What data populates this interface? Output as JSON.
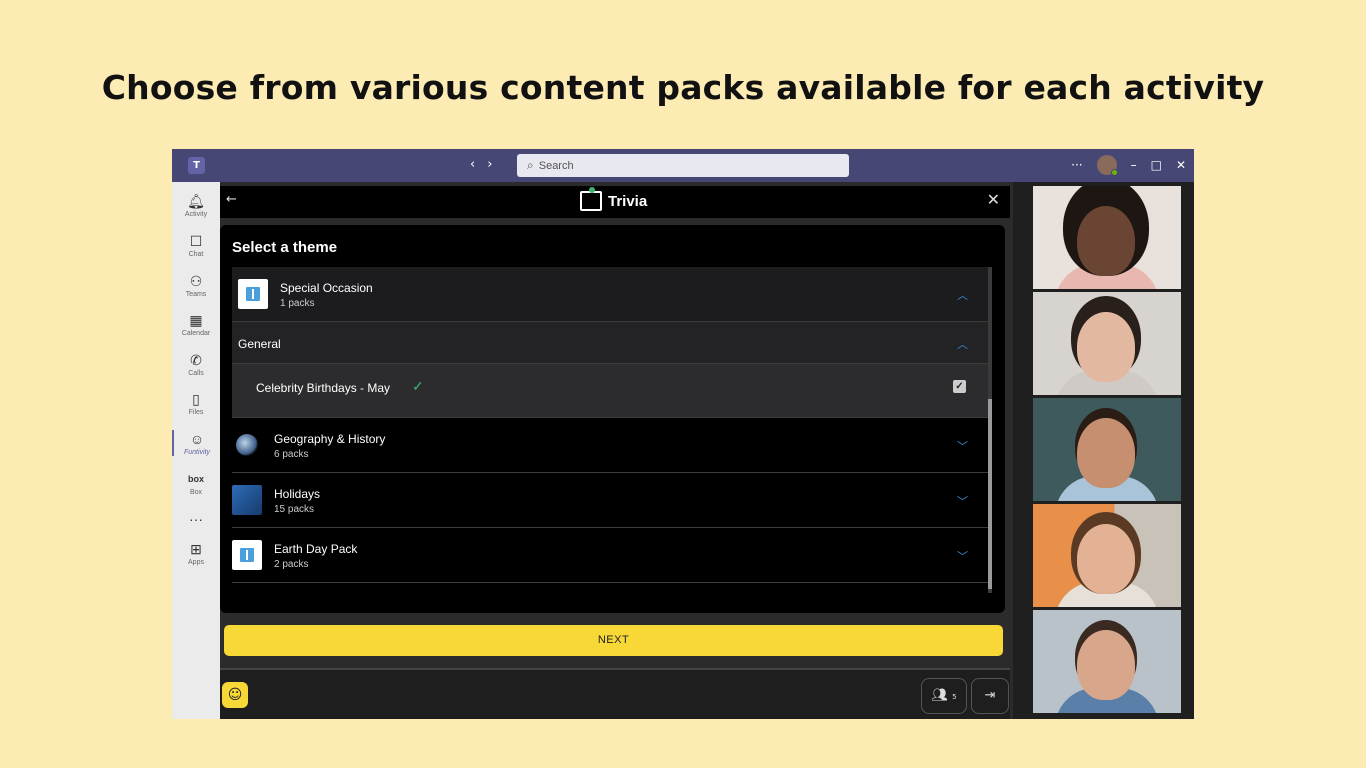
{
  "headline": "Choose from various content packs available for each activity",
  "titlebar": {
    "search_placeholder": "Search",
    "more": "···",
    "minimize": "–",
    "maximize": "□",
    "close": "✕"
  },
  "rail": {
    "items": [
      {
        "label": "Activity",
        "icon": "bell-icon"
      },
      {
        "label": "Chat",
        "icon": "chat-icon"
      },
      {
        "label": "Teams",
        "icon": "teams-icon"
      },
      {
        "label": "Calendar",
        "icon": "calendar-icon"
      },
      {
        "label": "Calls",
        "icon": "phone-icon"
      },
      {
        "label": "Files",
        "icon": "file-icon"
      },
      {
        "label": "Funtivity",
        "icon": "funtivity-icon"
      },
      {
        "label": "Box",
        "icon": "box-icon"
      },
      {
        "label": "Apps",
        "icon": "apps-icon"
      }
    ],
    "box_logo": "box",
    "more": "···"
  },
  "app": {
    "title": "Trivia",
    "panel_title": "Select a theme",
    "themes": [
      {
        "name": "Special Occasion",
        "count": "1 packs",
        "expanded": true
      },
      {
        "name": "Geography & History",
        "count": "6 packs",
        "expanded": false
      },
      {
        "name": "Holidays",
        "count": "15 packs",
        "expanded": false
      },
      {
        "name": "Earth Day Pack",
        "count": "2 packs",
        "expanded": false
      }
    ],
    "subgroup": "General",
    "pack": {
      "name": "Celebrity Birthdays - May",
      "selected": true
    },
    "next_label": "NEXT",
    "participants_count": "5"
  },
  "colors": {
    "accent": "#6264a7",
    "titlebar": "#464775",
    "next_button": "#f7d836",
    "chevron": "#3b8fd6",
    "check": "#3cb371"
  }
}
